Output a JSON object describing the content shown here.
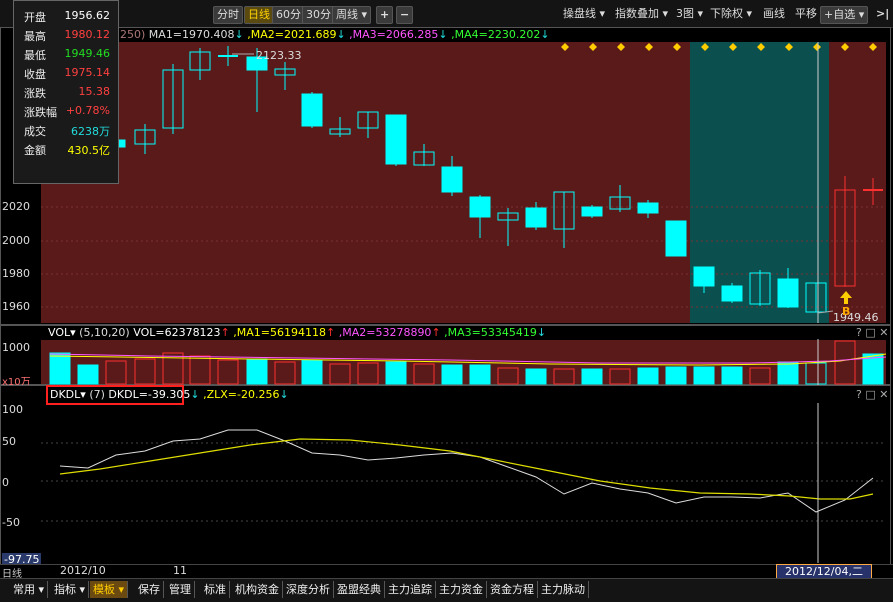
{
  "toolbar": {
    "fenshi": "分时",
    "rixian": "日线",
    "min60": "60分",
    "min30": "30分",
    "zhouxian": "周线",
    "plus": "+",
    "minus": "−",
    "caopanxian": "操盘线",
    "zhibiao_diejia": "指数叠加",
    "tu3": "3图",
    "xiachuquan": "下除权",
    "huaxian": "画线",
    "pingyi": "平移",
    "zixuan": "+自选",
    "collapse": "✕"
  },
  "ohlc": {
    "rows": [
      {
        "k": "开盘",
        "v": "1956.62",
        "c": "#ffffff"
      },
      {
        "k": "最高",
        "v": "1980.12",
        "c": "#ff4040"
      },
      {
        "k": "最低",
        "v": "1949.46",
        "c": "#22dd22"
      },
      {
        "k": "收盘",
        "v": "1975.14",
        "c": "#ff4040"
      },
      {
        "k": "涨跌",
        "v": "15.38",
        "c": "#ff4040"
      },
      {
        "k": "涨跌幅",
        "v": "+0.78%",
        "c": "#ff4040"
      },
      {
        "k": "成交",
        "v": "6238万",
        "c": "#22dddd"
      },
      {
        "k": "金额",
        "v": "430.5亿",
        "c": "#ffff00"
      }
    ]
  },
  "main_legend": {
    "prefix": "250)",
    "ma1": "MA1=1970.408",
    "ma2": ",MA2=2021.689",
    "ma3": ",MA3=2066.285",
    "ma4": ",MA4=2230.202",
    "high_label": "2123.33",
    "low_label": "1949.46",
    "signal_label": "B"
  },
  "main_axis": [
    "2020",
    "2000",
    "1980",
    "1960"
  ],
  "vol_legend": {
    "name": "VOL",
    "params": "(5,10,20)",
    "vol": "VOL=62378123",
    "ma1": ",MA1=56194118",
    "ma2": ",MA2=53278890",
    "ma3": ",MA3=53345419"
  },
  "vol_axis": {
    "top": "1000",
    "unit": "x10万"
  },
  "dkdl_legend": {
    "name": "DKDL",
    "param": "(7)",
    "value": "DKDL=-39.305",
    "zlx": ",ZLX=-20.256"
  },
  "dkdl_axis": [
    "100",
    "50",
    "0",
    "-50",
    "-97.75"
  ],
  "x_axis": {
    "left": "2012/10",
    "mid": "11",
    "cursor": "2012/12/04,二",
    "corner": "日线"
  },
  "bottom_tabs": {
    "changyong": "常用",
    "zhibiao": "指标",
    "moban": "模板",
    "baocun": "保存",
    "guanli": "管理",
    "biaozhun": "标准",
    "jigou": "机构资金",
    "shendu": "深度分析",
    "yingli": "盈盟经典",
    "zhuijin": "主力追踪",
    "zhuzijin": "主力资金",
    "fangcheng": "资金方程",
    "maidong": "主力脉动"
  },
  "colors": {
    "up": "#ff3030",
    "down": "#00ffff",
    "ma1": "#ffffff",
    "ma2": "#ffff00",
    "ma3": "#ff44ff",
    "ma4": "#00ff00",
    "bg_main": "#5a1a1a",
    "bg_highlight": "#0b4f4f"
  }
}
